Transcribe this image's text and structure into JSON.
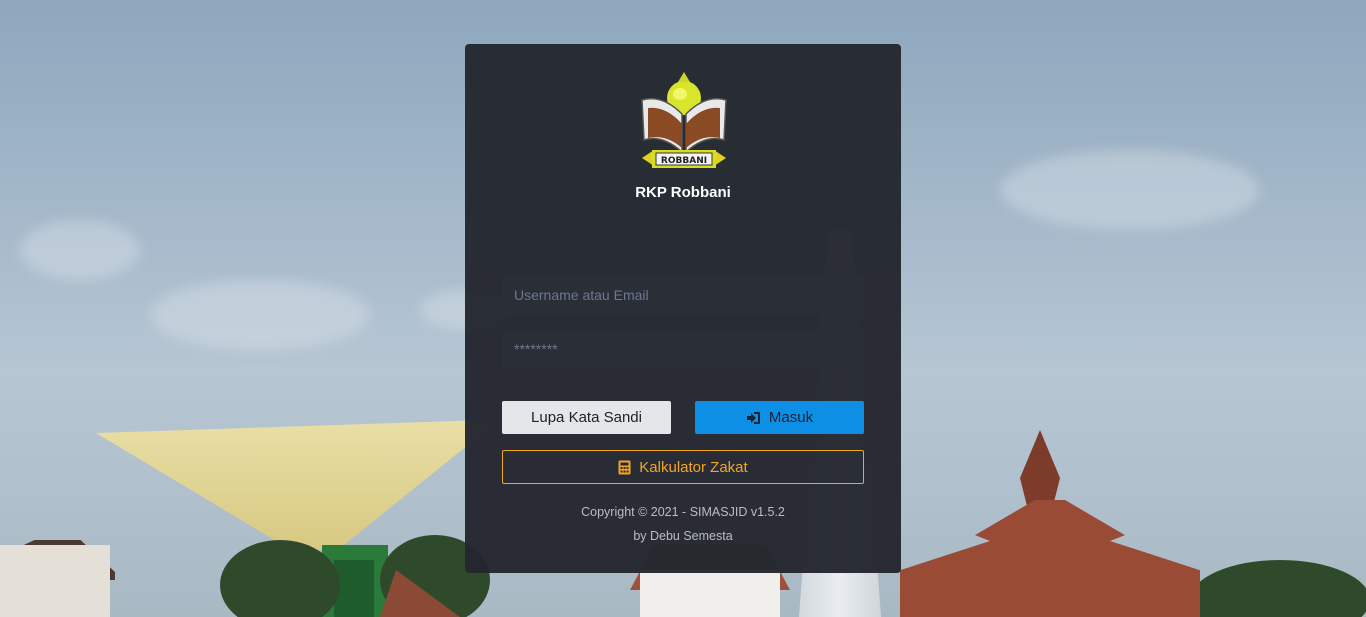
{
  "app": {
    "brand_name": "RKP Robbani",
    "logo_text": "ROBBANI"
  },
  "login_form": {
    "username_placeholder": "Username atau Email",
    "password_value": "********",
    "forgot_password_label": "Lupa Kata Sandi",
    "login_label": "Masuk",
    "login_icon": "sign-in-icon",
    "zakat_calculator_label": "Kalkulator Zakat",
    "zakat_icon": "calculator-icon"
  },
  "footer": {
    "copyright": "Copyright © 2021 - SIMASJID v1.5.2",
    "author": "by Debu Semesta"
  },
  "colors": {
    "card_bg": "#24272e",
    "primary": "#0d8fe6",
    "warning": "#f0a81e",
    "light": "#e4e7ea"
  }
}
